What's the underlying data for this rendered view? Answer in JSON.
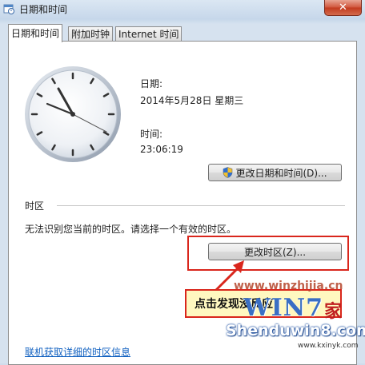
{
  "window": {
    "title": "日期和时间",
    "close_label": "✕"
  },
  "tabs": [
    {
      "label": "日期和时间",
      "active": true
    },
    {
      "label": "附加时钟",
      "active": false
    },
    {
      "label": "Internet 时间",
      "active": false
    }
  ],
  "datetime": {
    "date_label": "日期:",
    "date_value": "2014年5月28日 星期三",
    "time_label": "时间:",
    "time_value": "23:06:19",
    "change_datetime_button": "更改日期和时间(D)..."
  },
  "timezone": {
    "section_label": "时区",
    "message": "无法识别您当前的时区。请选择一个有效的时区。",
    "change_timezone_button": "更改时区(Z)..."
  },
  "annotation": {
    "callout_text": "点击发现没反应",
    "accent_color": "#d9261c"
  },
  "footer": {
    "link_text": "联机获取详细的时区信息"
  },
  "watermark": {
    "logo_text": "WIN7",
    "logo_char": "家",
    "overlay_text": "www.winzhijia.cn",
    "site_text": "Shenduwin8.com",
    "site_url": "www.kxinyk.com"
  }
}
